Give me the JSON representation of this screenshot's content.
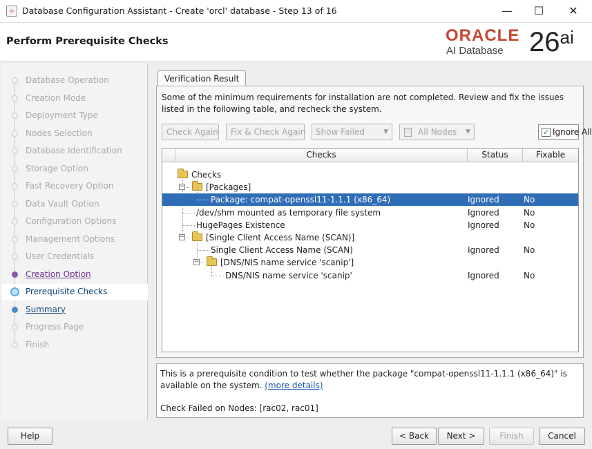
{
  "window": {
    "title": "Database Configuration Assistant - Create 'orcl' database - Step 13 of 16",
    "controls": {
      "minimize": "—",
      "maximize": "☐",
      "close": "✕"
    }
  },
  "header": {
    "page_title": "Perform Prerequisite Checks",
    "logo": {
      "brand": "ORACLE",
      "product": "AI Database",
      "version": "26",
      "version_suffix": "ai",
      "brand_color": "#c74634"
    }
  },
  "sidebar": {
    "steps": [
      {
        "label": "Database Operation",
        "state": "inactive"
      },
      {
        "label": "Creation Mode",
        "state": "inactive"
      },
      {
        "label": "Deployment Type",
        "state": "inactive"
      },
      {
        "label": "Nodes Selection",
        "state": "inactive"
      },
      {
        "label": "Database Identification",
        "state": "inactive"
      },
      {
        "label": "Storage Option",
        "state": "inactive"
      },
      {
        "label": "Fast Recovery Option",
        "state": "inactive"
      },
      {
        "label": "Data Vault Option",
        "state": "inactive"
      },
      {
        "label": "Configuration Options",
        "state": "inactive"
      },
      {
        "label": "Management Options",
        "state": "inactive"
      },
      {
        "label": "User Credentials",
        "state": "inactive"
      },
      {
        "label": "Creation Option",
        "state": "done"
      },
      {
        "label": "Prerequisite Checks",
        "state": "current"
      },
      {
        "label": "Summary",
        "state": "next"
      },
      {
        "label": "Progress Page",
        "state": "inactive"
      },
      {
        "label": "Finish",
        "state": "inactive"
      }
    ]
  },
  "tab": {
    "label": "Verification Result"
  },
  "panel": {
    "message": "Some of the minimum requirements for installation are not completed. Review and fix the issues listed in the following table, and recheck the system.",
    "toolbar": {
      "check_again": "Check Again",
      "fix_and_check_again": "Fix & Check Again",
      "filter_value": "Show Failed",
      "nodes_value": "All Nodes",
      "ignore_all_label": "Ignore All",
      "ignore_all_checked": true
    }
  },
  "table": {
    "columns": {
      "checks": "Checks",
      "status": "Status",
      "fixable": "Fixable"
    },
    "rows": [
      {
        "name": "Checks",
        "status": "",
        "fixable": ""
      },
      {
        "name": "[Packages]",
        "status": "",
        "fixable": ""
      },
      {
        "name": "Package: compat-openssl11-1.1.1 (x86_64)",
        "status": "Ignored",
        "fixable": "No",
        "selected": true
      },
      {
        "name": "/dev/shm mounted as temporary file system",
        "status": "Ignored",
        "fixable": "No"
      },
      {
        "name": "HugePages Existence",
        "status": "Ignored",
        "fixable": "No"
      },
      {
        "name": "[Single Client Access Name (SCAN)]",
        "status": "",
        "fixable": ""
      },
      {
        "name": "Single Client Access Name (SCAN)",
        "status": "Ignored",
        "fixable": "No"
      },
      {
        "name": "[DNS/NIS name service 'scanip']",
        "status": "",
        "fixable": ""
      },
      {
        "name": "DNS/NIS name service 'scanip'",
        "status": "Ignored",
        "fixable": "No"
      }
    ]
  },
  "details": {
    "description": "This is a prerequisite condition to test whether the package \"compat-openssl11-1.1.1 (x86_64)\" is available on the system.",
    "more_details_link": "(more details)",
    "failed_nodes": "Check Failed on Nodes: [rac02, rac01]"
  },
  "footer": {
    "help": "Help",
    "back": "< Back",
    "next": "Next >",
    "finish": "Finish",
    "cancel": "Cancel"
  }
}
